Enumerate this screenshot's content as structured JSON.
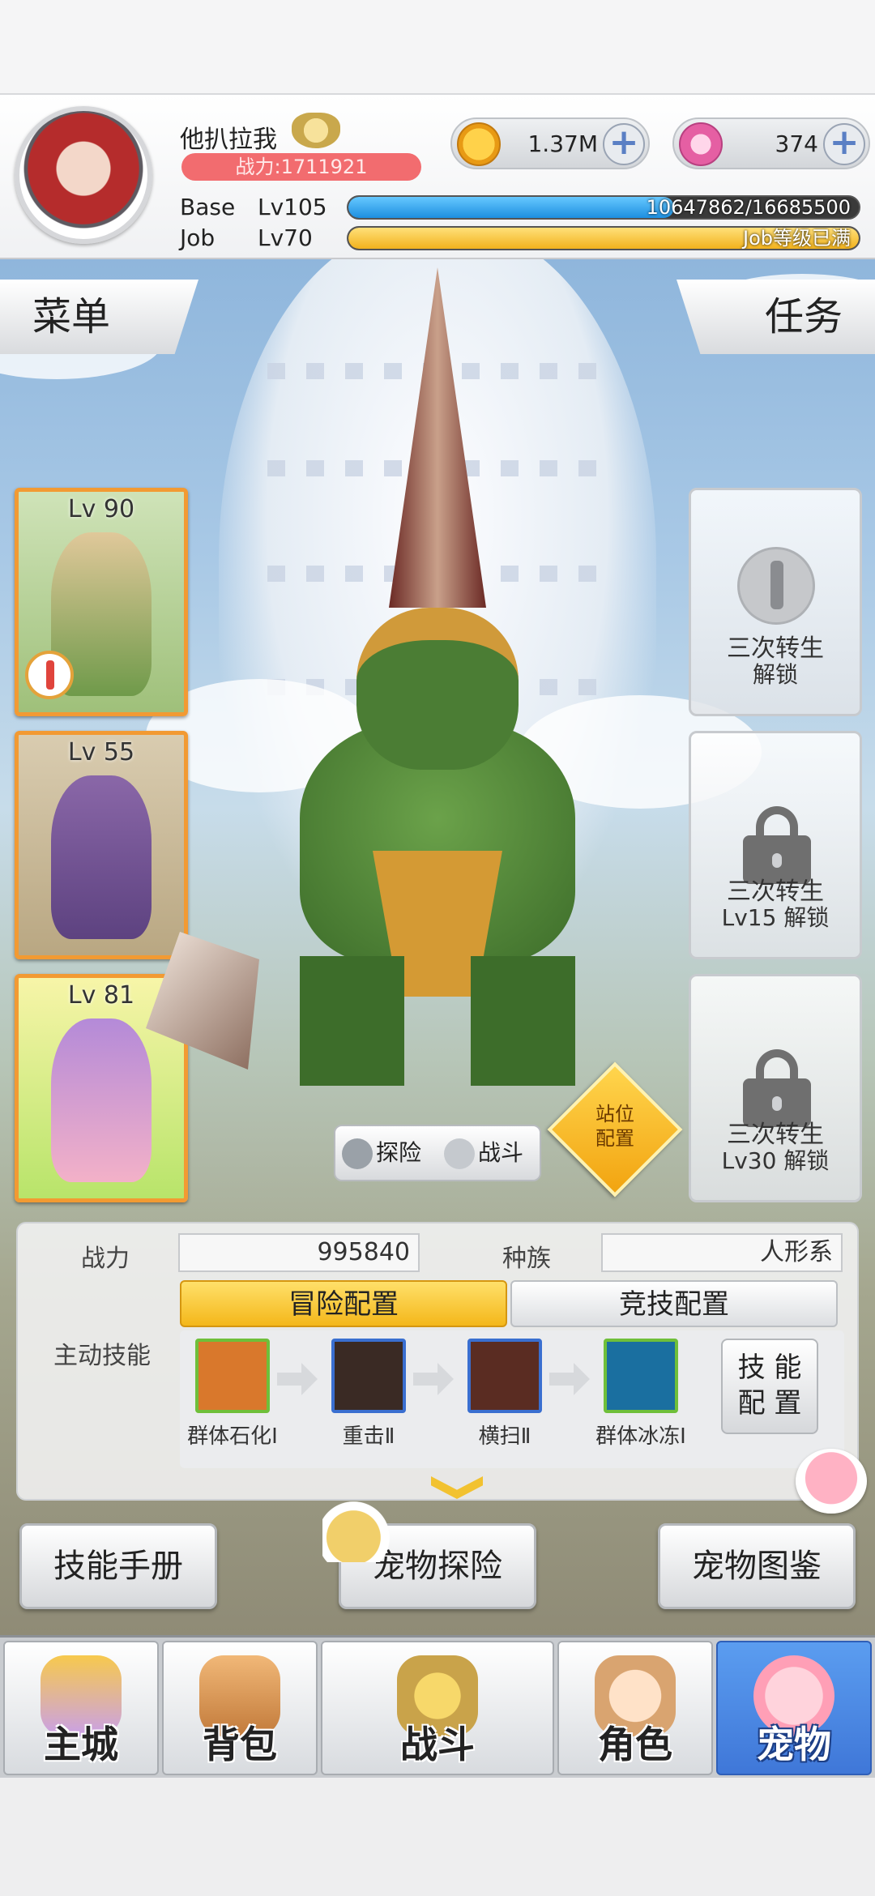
{
  "player": {
    "name": "他扒拉我",
    "power_label": "战力:1711921"
  },
  "currency": {
    "zeny": "1.37M",
    "gems": "374"
  },
  "levels": {
    "base_label": "Base",
    "base_level": "Lv105",
    "base_exp": "10647862/16685500",
    "base_fraction": 0.638,
    "job_label": "Job",
    "job_level": "Lv70",
    "job_exp": "Job等级已满",
    "job_fraction": 1.0
  },
  "side_tabs": {
    "menu": "菜单",
    "quests": "任务"
  },
  "pets": [
    {
      "level": "Lv 90"
    },
    {
      "level": "Lv 55"
    },
    {
      "level": "Lv 81"
    }
  ],
  "rebirth_slots": [
    {
      "line1": "三次转生",
      "line2": "解锁"
    },
    {
      "line1": "三次转生",
      "line2": "Lv15 解锁"
    },
    {
      "line1": "三次转生",
      "line2": "Lv30 解锁"
    }
  ],
  "mode_switch": {
    "explore": "探险",
    "battle": "战斗"
  },
  "stance": {
    "line1": "站位",
    "line2": "配置"
  },
  "stats": {
    "power_label": "战力",
    "power_value": "995840",
    "race_label": "种族",
    "race_value": "人形系",
    "active_skills_label": "主动技能"
  },
  "config_tabs": {
    "adventure": "冒险配置",
    "arena": "竞技配置"
  },
  "skills": [
    {
      "name": "群体石化Ⅰ",
      "border": "#6fbf3a",
      "bg": "#d9782c"
    },
    {
      "name": "重击Ⅱ",
      "border": "#3a6fd0",
      "bg": "#3a2a24"
    },
    {
      "name": "横扫Ⅱ",
      "border": "#3a6fd0",
      "bg": "#5a2c22"
    },
    {
      "name": "群体冰冻Ⅰ",
      "border": "#6fbf3a",
      "bg": "#1a6fa0"
    }
  ],
  "skill_config": {
    "line1": "技 能",
    "line2": "配 置"
  },
  "actions": {
    "skill_book": "技能手册",
    "pet_explore": "宠物探险",
    "pet_codex": "宠物图鉴"
  },
  "nav": {
    "city": "主城",
    "bag": "背包",
    "battle": "战斗",
    "character": "角色",
    "pet": "宠物"
  }
}
